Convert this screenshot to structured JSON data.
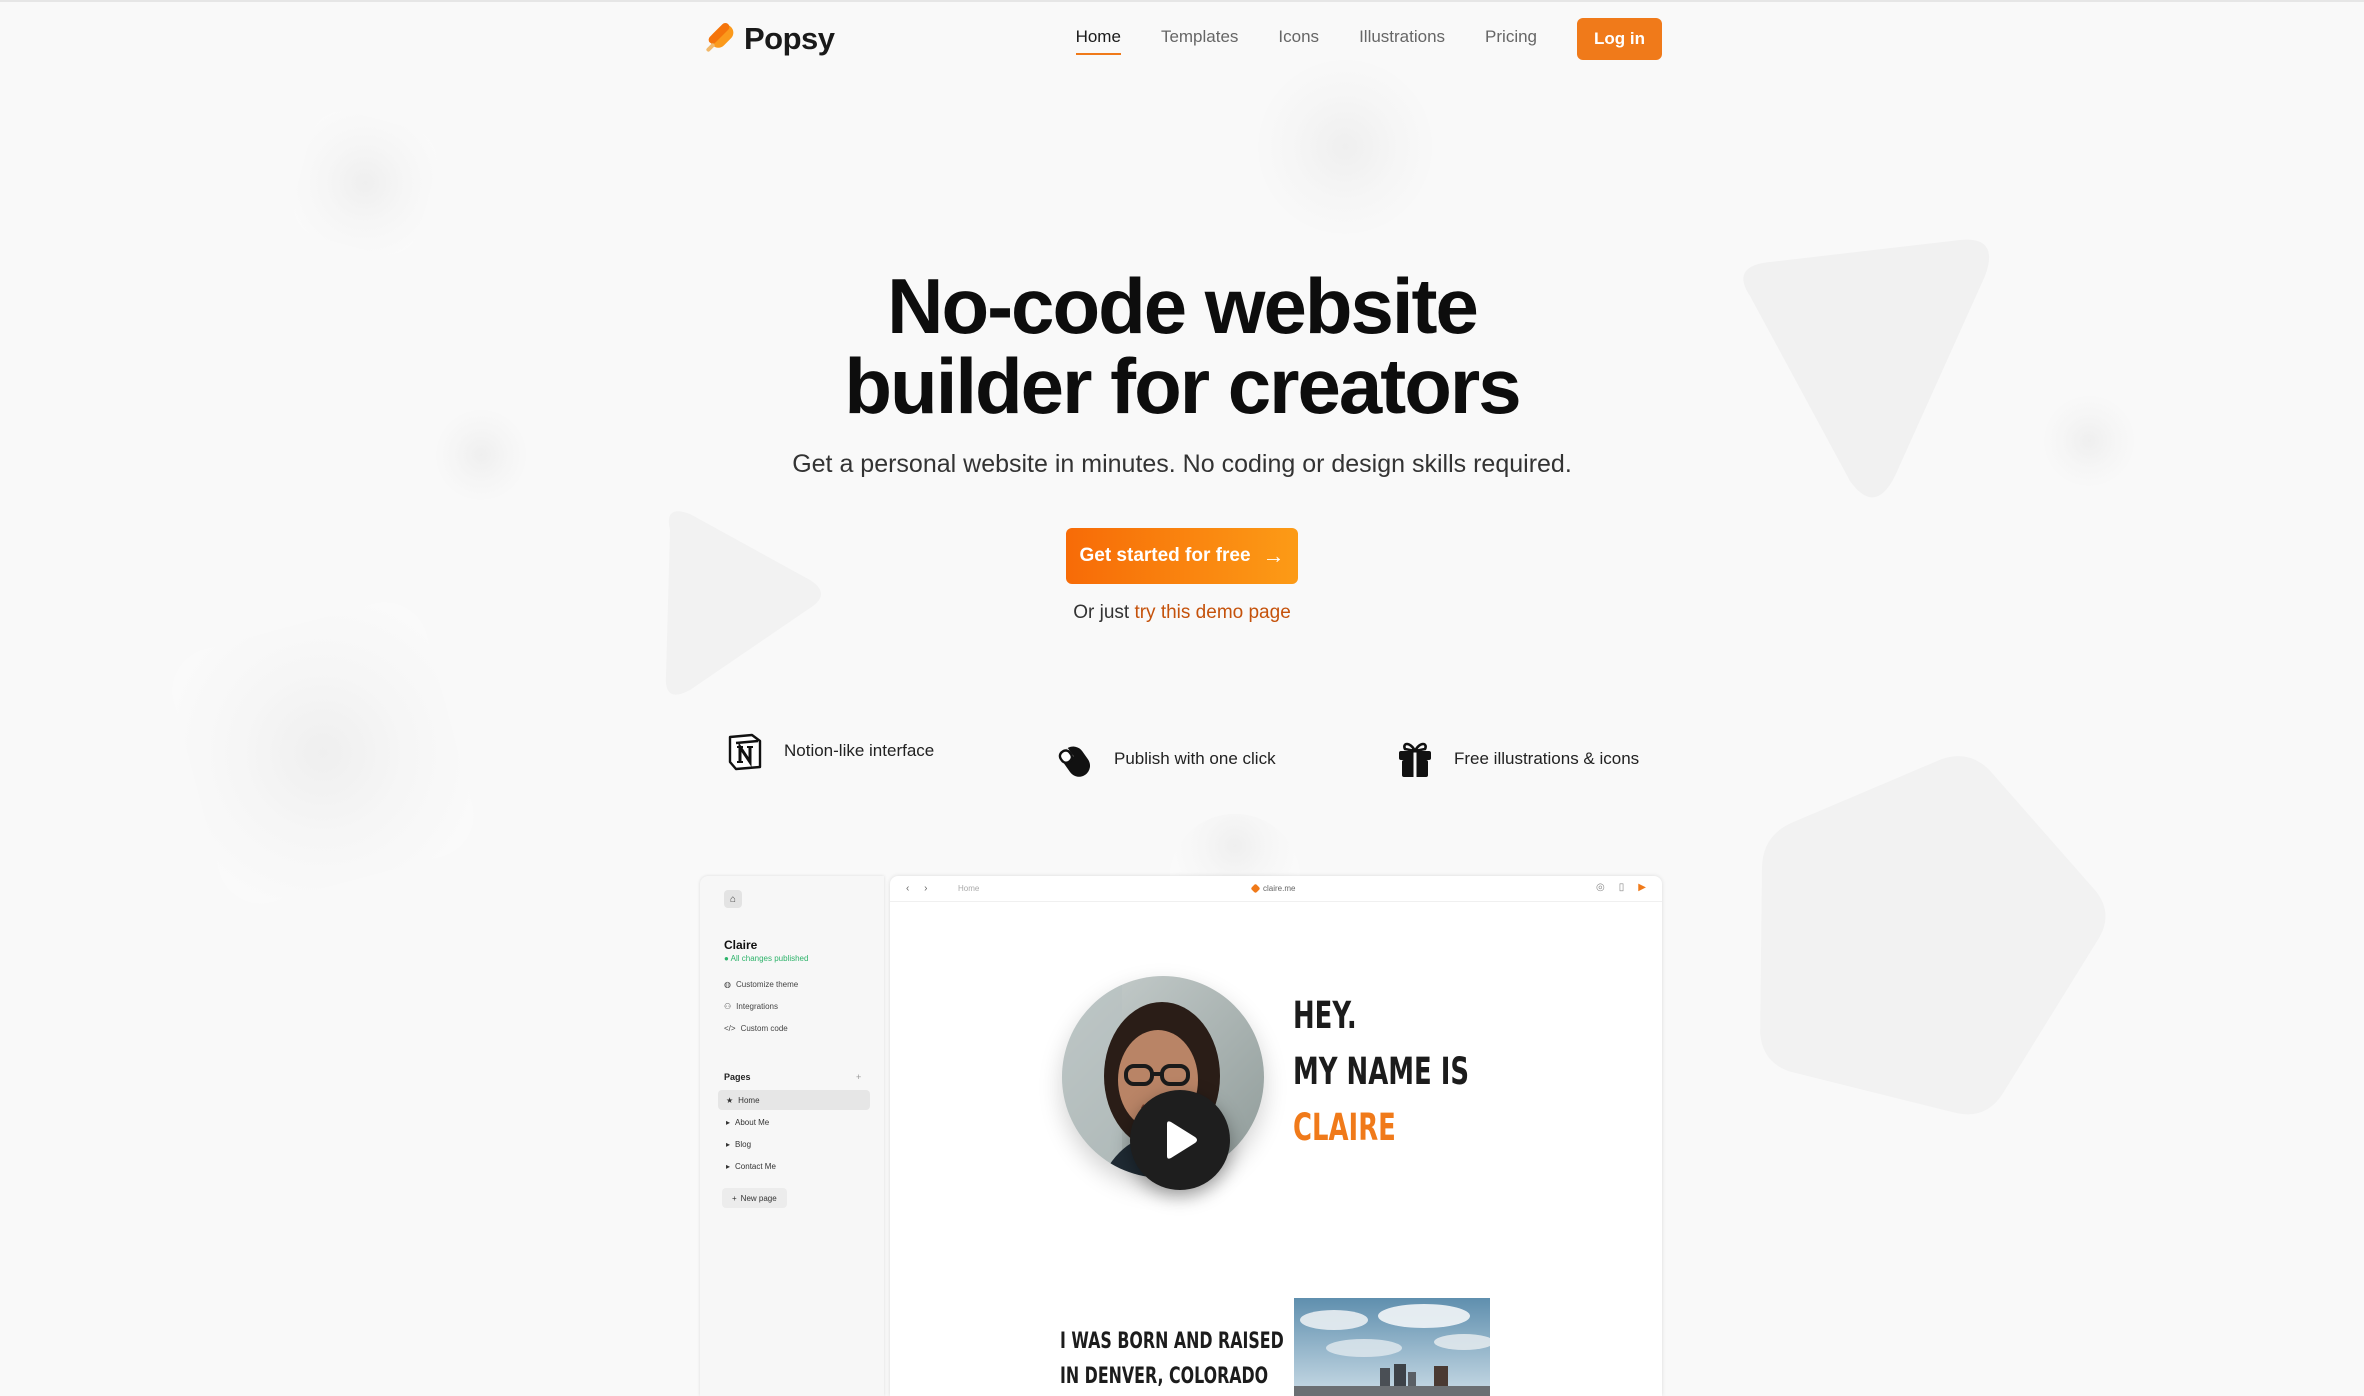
{
  "brand": {
    "name": "Popsy",
    "accent": "#f07a1a"
  },
  "nav": {
    "links": [
      {
        "label": "Home",
        "active": true
      },
      {
        "label": "Templates",
        "active": false
      },
      {
        "label": "Icons",
        "active": false
      },
      {
        "label": "Illustrations",
        "active": false
      },
      {
        "label": "Pricing",
        "active": false
      }
    ],
    "login_label": "Log in"
  },
  "hero": {
    "title_line1": "No-code website",
    "title_line2": "builder for creators",
    "subtitle": "Get a personal website in minutes. No coding or design skills required.",
    "cta_label": "Get started for free",
    "demo_prefix": "Or just",
    "demo_link": "try this demo page"
  },
  "features": [
    {
      "label": "Notion-like interface",
      "icon": "notion-icon"
    },
    {
      "label": "Publish with one click",
      "icon": "mouse-click-icon"
    },
    {
      "label": "Free illustrations & icons",
      "icon": "gift-icon"
    }
  ],
  "mockup": {
    "sidebar": {
      "site_name": "Claire",
      "status": "All changes published",
      "settings": [
        "Customize theme",
        "Integrations",
        "Custom code"
      ],
      "pages_title": "Pages",
      "pages": [
        "Home",
        "About Me",
        "Blog",
        "Contact Me"
      ],
      "new_page": "New page"
    },
    "topbar": {
      "crumb": "Home",
      "url": "claire.me"
    },
    "content": {
      "hey": "HEY.",
      "name_line": "MY NAME IS",
      "name": "CLAIRE",
      "born_line1": "I WAS BORN AND RAISED",
      "born_line2": "IN DENVER, COLORADO"
    }
  }
}
